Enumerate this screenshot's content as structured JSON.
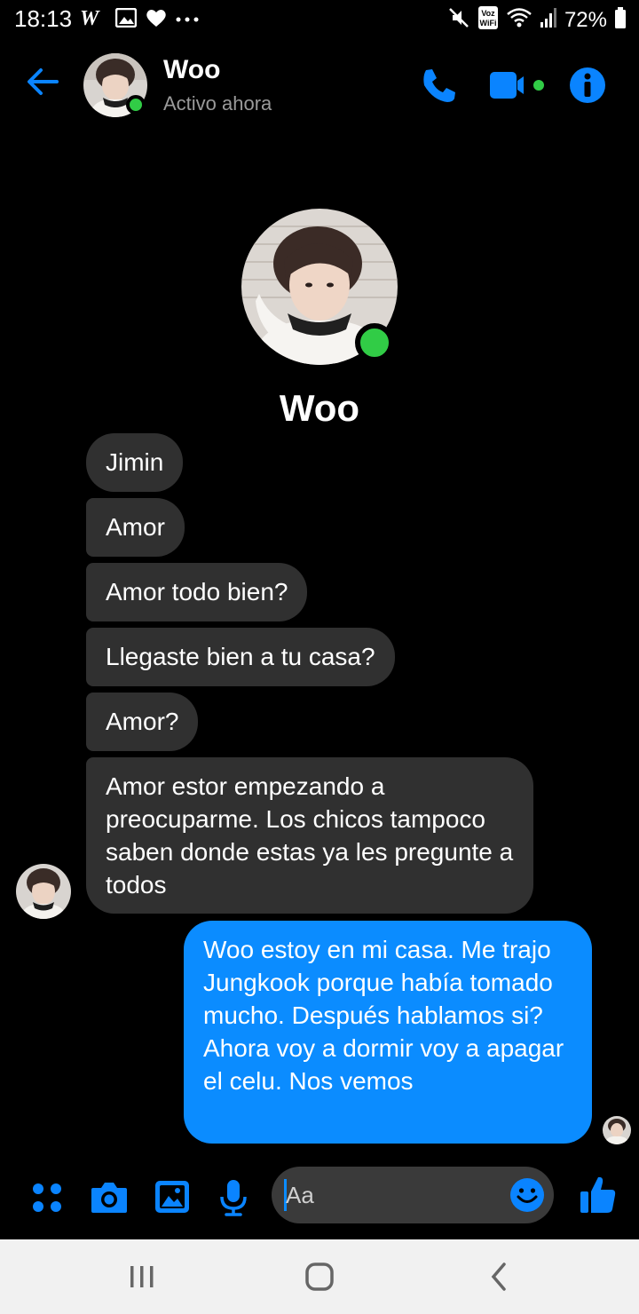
{
  "status_bar": {
    "time": "18:13",
    "battery": "72%",
    "left_icons": [
      "w-app-icon",
      "gallery-icon",
      "heart-icon",
      "more-dots-icon"
    ],
    "right_icons": [
      "mute-icon",
      "vowifi-icon",
      "wifi-icon",
      "signal-icon",
      "battery-icon"
    ]
  },
  "header": {
    "name": "Woo",
    "status": "Activo ahora",
    "accent": "#0a84ff",
    "online_color": "#31cc46"
  },
  "profile": {
    "name": "Woo"
  },
  "messages": [
    {
      "from": "them",
      "text": "Jimin"
    },
    {
      "from": "them",
      "text": "Amor"
    },
    {
      "from": "them",
      "text": "Amor todo bien?"
    },
    {
      "from": "them",
      "text": "Llegaste bien a tu casa?"
    },
    {
      "from": "them",
      "text": "Amor?"
    },
    {
      "from": "them",
      "text": "Amor estor empezando a preocuparme. Los chicos tampoco saben donde estas ya les pregunte a todos"
    },
    {
      "from": "me",
      "text": "Woo estoy en mi casa. Me trajo Jungkook porque había tomado mucho. Después hablamos si? Ahora voy a dormir voy a apagar el celu. Nos vemos"
    }
  ],
  "composer": {
    "placeholder": "Aa"
  },
  "colors": {
    "received_bubble": "#303030",
    "sent_bubble": "#0b8cff",
    "background": "#000000",
    "nav_background": "#f1f1f1"
  }
}
